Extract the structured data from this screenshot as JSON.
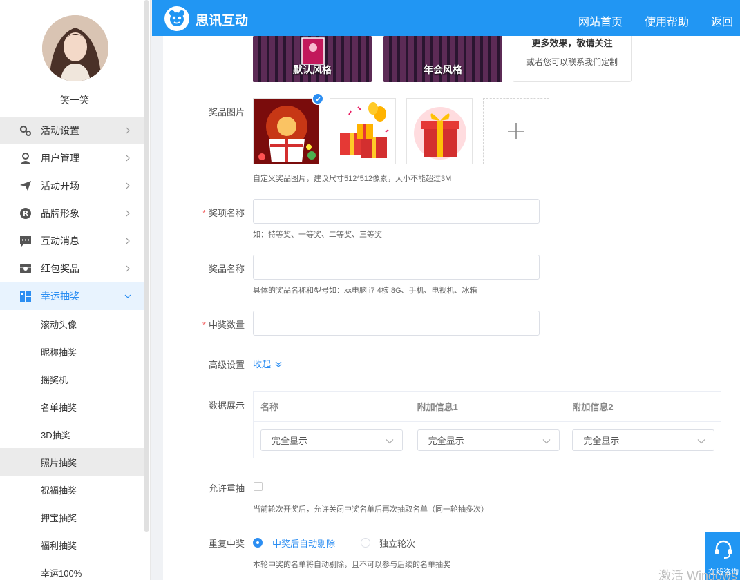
{
  "user": {
    "name": "笑一笑"
  },
  "sidebar": {
    "menu": [
      {
        "label": "活动设置",
        "icon": "gears-icon"
      },
      {
        "label": "用户管理",
        "icon": "user-icon"
      },
      {
        "label": "活动开场",
        "icon": "paper-plane-icon"
      },
      {
        "label": "品牌形象",
        "icon": "registered-icon"
      },
      {
        "label": "互动消息",
        "icon": "chat-icon"
      },
      {
        "label": "红包奖品",
        "icon": "gift-box-icon"
      },
      {
        "label": "幸运抽奖",
        "icon": "lottery-icon"
      }
    ],
    "submenu": [
      "滚动头像",
      "昵称抽奖",
      "摇奖机",
      "名单抽奖",
      "3D抽奖",
      "照片抽奖",
      "祝福抽奖",
      "押宝抽奖",
      "福利抽奖",
      "幸运100%"
    ]
  },
  "header": {
    "brand": "思讯互动",
    "nav": [
      "网站首页",
      "使用帮助",
      "返回"
    ]
  },
  "styles": {
    "default_label": "默认风格",
    "annual_label": "年会风格",
    "more_title": "更多效果，敬请关注",
    "more_sub": "或者您可以联系我们定制"
  },
  "form": {
    "prize_image_label": "奖品图片",
    "prize_image_hint": "自定义奖品图片，建议尺寸512*512像素，大小不能超过3M",
    "award_name_label": "奖项名称",
    "award_name_hint": "如：特等奖、一等奖、二等奖、三等奖",
    "award_name_value": "",
    "prize_name_label": "奖品名称",
    "prize_name_hint": "具体的奖品名称和型号如：xx电脑 i7 4核 8G、手机、电视机、冰箱",
    "prize_name_value": "",
    "winner_count_label": "中奖数量",
    "winner_count_value": "",
    "advanced_label": "高级设置",
    "collapse_label": "收起",
    "data_display_label": "数据展示",
    "table": {
      "headers": [
        "名称",
        "附加信息1",
        "附加信息2"
      ],
      "selects": [
        "完全显示",
        "完全显示",
        "完全显示"
      ]
    },
    "redraw_label": "允许重抽",
    "redraw_hint": "当前轮次开奖后，允许关闭中奖名单后再次抽取名单（同一轮抽多次）",
    "repeat_label": "重复中奖",
    "repeat_options": [
      "中奖后自动剔除",
      "独立轮次"
    ],
    "repeat_hint": "本轮中奖的名单将自动剔除，且不可以参与后续的名单抽奖"
  },
  "float": {
    "label": "在线咨询"
  },
  "watermark": "激活 Windows",
  "colors": {
    "primary": "#2196f3",
    "accent": "#2c8ef2",
    "required": "#f56c6c"
  }
}
